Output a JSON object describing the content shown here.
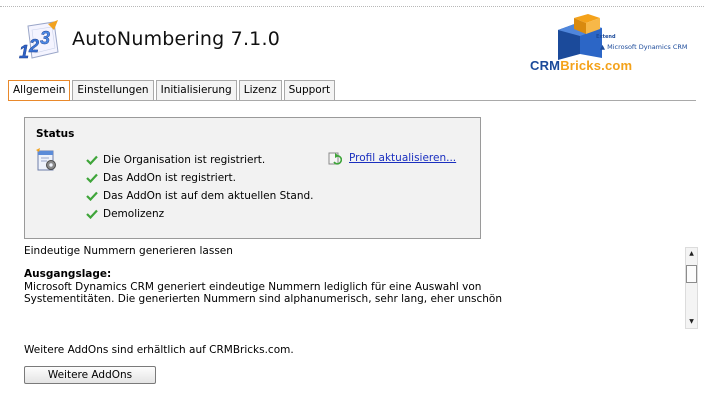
{
  "header": {
    "title": "AutoNumbering 7.1.0",
    "app_icon": "123-numbering-logo-icon",
    "brand": {
      "word_part1": "CRM",
      "word_part2": "Bricks.com",
      "tagline_extend": "Extend",
      "tagline_product": "Microsoft Dynamics CRM",
      "colors": {
        "blue": "#1b4a9a",
        "orange": "#f4a21a"
      }
    }
  },
  "tabs": [
    {
      "label": "Allgemein",
      "active": true
    },
    {
      "label": "Einstellungen",
      "active": false
    },
    {
      "label": "Initialisierung",
      "active": false
    },
    {
      "label": "Lizenz",
      "active": false
    },
    {
      "label": "Support",
      "active": false
    }
  ],
  "status": {
    "title": "Status",
    "icon": "settings-document-icon",
    "items": [
      "Die Organisation ist registriert.",
      "Das AddOn ist registriert.",
      "Das AddOn ist auf dem aktuellen Stand.",
      "Demolizenz"
    ],
    "refresh_link": "Profil aktualisieren..."
  },
  "description": {
    "intro": "Eindeutige Nummern generieren lassen",
    "heading": "Ausgangslage:",
    "line1": "Microsoft Dynamics CRM generiert eindeutige Nummern lediglich für eine Auswahl von",
    "line2": "Systementitäten. Die generierten Nummern sind alphanumerisch, sehr lang, eher unschön"
  },
  "more": {
    "text": "Weitere AddOns sind erhältlich auf CRMBricks.com.",
    "button_label": "Weitere AddOns"
  },
  "colors": {
    "active_tab_border": "#e9892b",
    "link": "#1a2fbf",
    "check": "#3fa53a"
  }
}
